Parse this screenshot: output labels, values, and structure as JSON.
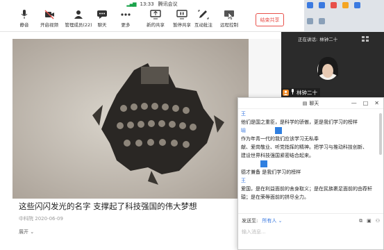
{
  "meeting": {
    "time": "13:33",
    "app_name": "腾讯会议",
    "tools": [
      {
        "label": "静音",
        "icon": "microphone-icon"
      },
      {
        "label": "开启视频",
        "icon": "camera-off-icon"
      },
      {
        "label": "管理成员(22)",
        "icon": "members-icon"
      },
      {
        "label": "聊天",
        "icon": "chat-icon"
      },
      {
        "label": "更多",
        "icon": "more-icon"
      },
      {
        "label": "新的共享",
        "icon": "share-screen-icon"
      },
      {
        "label": "暂停共享",
        "icon": "pause-share-icon"
      },
      {
        "label": "互动批注",
        "icon": "annotate-icon"
      },
      {
        "label": "远程控制",
        "icon": "remote-control-icon"
      }
    ],
    "end_share": "结束共享"
  },
  "article": {
    "title": "这些闪闪发光的名字 支撑起了科技强国的伟大梦想",
    "source": "中科院",
    "date": "2020-06-09",
    "expand": "展开"
  },
  "video": {
    "speaking_label": "正在讲话:",
    "speaking_name": "林钟二十",
    "tag_name": "林钟二十"
  },
  "chat": {
    "title": "聊天",
    "lines": [
      {
        "type": "sender",
        "text": "王"
      },
      {
        "type": "text",
        "text": "他们是国之重臣，是科学的骄傲，更是我们学习的榜样"
      },
      {
        "type": "sender",
        "text": "喻"
      },
      {
        "type": "text",
        "text": "作为年青一代的我们应该学习无私奉"
      },
      {
        "type": "text",
        "text": "献、爱岗敬业、听党指挥的精神。把学习与推动科技创新、"
      },
      {
        "type": "text",
        "text": "建设世界科技强国紧密结合起来。"
      },
      {
        "type": "text",
        "text": "德才兼备  是我们学习的榜样"
      },
      {
        "type": "sender",
        "text": "王"
      },
      {
        "type": "text",
        "text": "爱国，是在利益面前的舍身取义；是在民族裹足面前的由荐轩"
      },
      {
        "type": "text",
        "text": "辕；是在荣辱面前的拼尽全力。"
      }
    ],
    "send_to_label": "发送至:",
    "send_to_value": "所有人",
    "input_placeholder": "输入消息..."
  },
  "colors": {
    "accent": "#2f7fe0",
    "end_share": "#e8504a",
    "video_bg": "#2b2b2b",
    "speaker_avatar": "#f08c2a"
  }
}
